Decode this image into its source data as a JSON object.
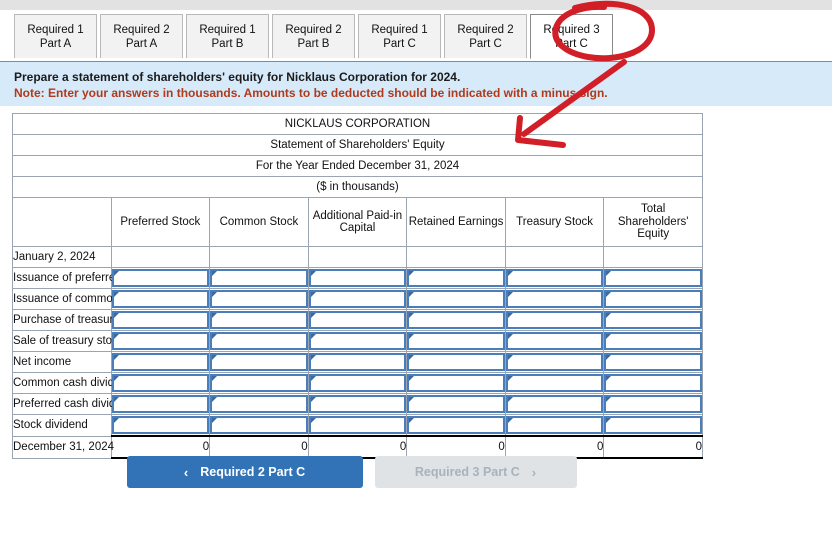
{
  "tabs": [
    {
      "line1": "Required 1",
      "line2": "Part A",
      "active": false
    },
    {
      "line1": "Required 2",
      "line2": "Part A",
      "active": false
    },
    {
      "line1": "Required 1",
      "line2": "Part B",
      "active": false
    },
    {
      "line1": "Required 2",
      "line2": "Part B",
      "active": false
    },
    {
      "line1": "Required 1",
      "line2": "Part C",
      "active": false
    },
    {
      "line1": "Required 2",
      "line2": "Part C",
      "active": false
    },
    {
      "line1": "Required 3",
      "line2": "Part C",
      "active": true
    }
  ],
  "instructions": {
    "line1": "Prepare a statement of shareholders' equity for Nicklaus Corporation for 2024.",
    "line2": "Note: Enter your answers in thousands. Amounts to be deducted should be indicated with a minus sign."
  },
  "sheet": {
    "title_lines": [
      "NICKLAUS CORPORATION",
      "Statement of Shareholders' Equity",
      "For the Year Ended December 31, 2024",
      "($ in thousands)"
    ],
    "column_headers": [
      "",
      "Preferred Stock",
      "Common Stock",
      "Additional Paid-in Capital",
      "Retained Earnings",
      "Treasury Stock",
      "Total Shareholders' Equity"
    ],
    "rows": [
      {
        "label": "January 2, 2024",
        "type": "plain",
        "values": [
          "",
          "",
          "",
          "",
          "",
          ""
        ]
      },
      {
        "label": "Issuance of preferred stock",
        "type": "input",
        "values": [
          "",
          "",
          "",
          "",
          "",
          ""
        ]
      },
      {
        "label": "Issuance of common stock",
        "type": "input",
        "values": [
          "",
          "",
          "",
          "",
          "",
          ""
        ]
      },
      {
        "label": "Purchase of treasury stock",
        "type": "input",
        "values": [
          "",
          "",
          "",
          "",
          "",
          ""
        ]
      },
      {
        "label": "Sale of treasury stock",
        "type": "input",
        "values": [
          "",
          "",
          "",
          "",
          "",
          ""
        ]
      },
      {
        "label": "Net income",
        "type": "input",
        "values": [
          "",
          "",
          "",
          "",
          "",
          ""
        ]
      },
      {
        "label": "Common cash dividends",
        "type": "input",
        "values": [
          "",
          "",
          "",
          "",
          "",
          ""
        ]
      },
      {
        "label": "Preferred cash dividends",
        "type": "input",
        "values": [
          "",
          "",
          "",
          "",
          "",
          ""
        ]
      },
      {
        "label": "Stock dividend",
        "type": "input",
        "values": [
          "",
          "",
          "",
          "",
          "",
          ""
        ]
      },
      {
        "label": "December 31, 2024",
        "type": "total",
        "values": [
          "0",
          "0",
          "0",
          "0",
          "0",
          "0"
        ]
      }
    ]
  },
  "nav": {
    "prev_label": "Required 2 Part C",
    "next_label": "Required 3 Part C",
    "prev_chevron": "‹",
    "next_chevron": "›"
  },
  "colors": {
    "header_blue": "#7fafe3",
    "banner_blue": "#d7eafa",
    "input_border": "#4a7ebb",
    "button_blue": "#3273b8",
    "annotation_red": "#d21f27",
    "note_red": "#b03a1a"
  },
  "annotations": [
    {
      "name": "circle-around-active-tab",
      "shape": "ellipse"
    },
    {
      "name": "arrow-to-statement-title",
      "shape": "arrow"
    }
  ]
}
